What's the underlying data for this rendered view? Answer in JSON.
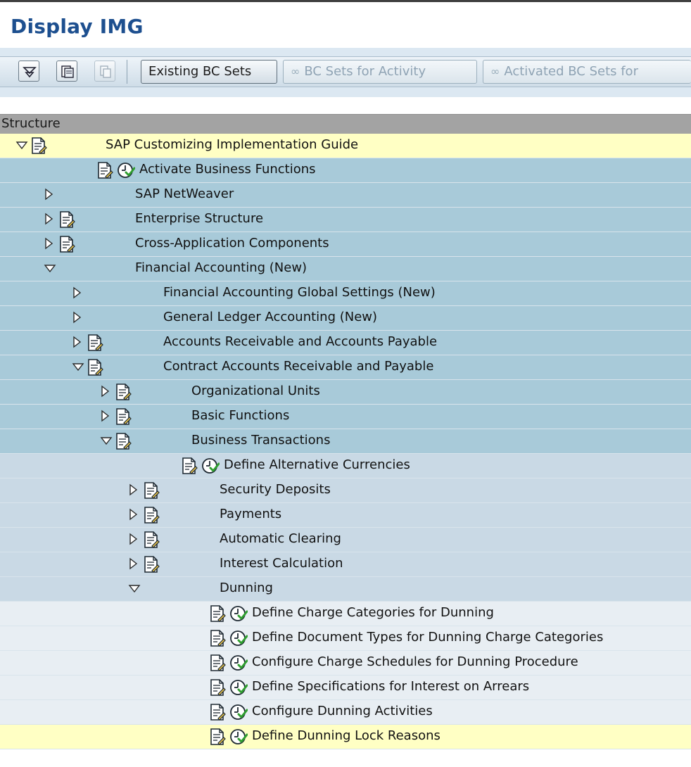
{
  "window": {
    "title": "Display IMG"
  },
  "toolbar": {
    "icons": [
      "expand-subtree-icon",
      "document-icon",
      "copy-icon"
    ],
    "buttons": [
      {
        "label": "Existing BC Sets",
        "enabled": true
      },
      {
        "label": "BC Sets for Activity",
        "enabled": false
      },
      {
        "label": "Activated BC Sets for",
        "enabled": false
      }
    ]
  },
  "tree": {
    "header": "Structure",
    "rows": [
      {
        "label": "SAP Customizing Implementation Guide",
        "level": 0,
        "expander": "expanded",
        "doc": true,
        "clock": false,
        "color": "#ffffc4"
      },
      {
        "label": "Activate Business Functions",
        "level": 1,
        "expander": "none",
        "doc": true,
        "clock": true,
        "color": "#a8cad9"
      },
      {
        "label": "SAP NetWeaver",
        "level": 1,
        "expander": "collapsed",
        "doc": false,
        "clock": false,
        "color": "#a8cad9"
      },
      {
        "label": "Enterprise Structure",
        "level": 1,
        "expander": "collapsed",
        "doc": true,
        "clock": false,
        "color": "#a8cad9"
      },
      {
        "label": "Cross-Application Components",
        "level": 1,
        "expander": "collapsed",
        "doc": true,
        "clock": false,
        "color": "#a8cad9"
      },
      {
        "label": "Financial Accounting (New)",
        "level": 1,
        "expander": "expanded",
        "doc": false,
        "clock": false,
        "color": "#a8cad9"
      },
      {
        "label": "Financial Accounting Global Settings (New)",
        "level": 2,
        "expander": "collapsed",
        "doc": false,
        "clock": false,
        "color": "#a8cad9"
      },
      {
        "label": "General Ledger Accounting (New)",
        "level": 2,
        "expander": "collapsed",
        "doc": false,
        "clock": false,
        "color": "#a8cad9"
      },
      {
        "label": "Accounts Receivable and Accounts Payable",
        "level": 2,
        "expander": "collapsed",
        "doc": true,
        "clock": false,
        "color": "#a8cad9"
      },
      {
        "label": "Contract Accounts Receivable and Payable",
        "level": 2,
        "expander": "expanded",
        "doc": true,
        "clock": false,
        "color": "#a8cad9"
      },
      {
        "label": "Organizational Units",
        "level": 3,
        "expander": "collapsed",
        "doc": true,
        "clock": false,
        "color": "#a8cad9"
      },
      {
        "label": "Basic Functions",
        "level": 3,
        "expander": "collapsed",
        "doc": true,
        "clock": false,
        "color": "#a8cad9"
      },
      {
        "label": "Business Transactions",
        "level": 3,
        "expander": "expanded",
        "doc": true,
        "clock": false,
        "color": "#a8cad9"
      },
      {
        "label": "Define Alternative Currencies",
        "level": 4,
        "expander": "none",
        "doc": true,
        "clock": true,
        "color": "#c9d9e5"
      },
      {
        "label": "Security Deposits",
        "level": 4,
        "expander": "collapsed",
        "doc": true,
        "clock": false,
        "color": "#c9d9e5"
      },
      {
        "label": "Payments",
        "level": 4,
        "expander": "collapsed",
        "doc": true,
        "clock": false,
        "color": "#c9d9e5"
      },
      {
        "label": "Automatic Clearing",
        "level": 4,
        "expander": "collapsed",
        "doc": true,
        "clock": false,
        "color": "#c9d9e5"
      },
      {
        "label": "Interest Calculation",
        "level": 4,
        "expander": "collapsed",
        "doc": true,
        "clock": false,
        "color": "#c9d9e5"
      },
      {
        "label": "Dunning",
        "level": 4,
        "expander": "expanded",
        "doc": false,
        "clock": false,
        "color": "#c9d9e5"
      },
      {
        "label": "Define Charge Categories for Dunning",
        "level": 5,
        "expander": "none",
        "doc": true,
        "clock": true,
        "color": "#e8eef3"
      },
      {
        "label": "Define Document Types for Dunning Charge Categories",
        "level": 5,
        "expander": "none",
        "doc": true,
        "clock": true,
        "color": "#e8eef3"
      },
      {
        "label": "Configure Charge Schedules for Dunning Procedure",
        "level": 5,
        "expander": "none",
        "doc": true,
        "clock": true,
        "color": "#e8eef3"
      },
      {
        "label": "Define Specifications for Interest on Arrears",
        "level": 5,
        "expander": "none",
        "doc": true,
        "clock": true,
        "color": "#e8eef3"
      },
      {
        "label": "Configure Dunning Activities",
        "level": 5,
        "expander": "none",
        "doc": true,
        "clock": true,
        "color": "#e8eef3"
      },
      {
        "label": "Define Dunning Lock Reasons",
        "level": 5,
        "expander": "none",
        "doc": true,
        "clock": true,
        "color": "#ffffc4"
      }
    ]
  }
}
